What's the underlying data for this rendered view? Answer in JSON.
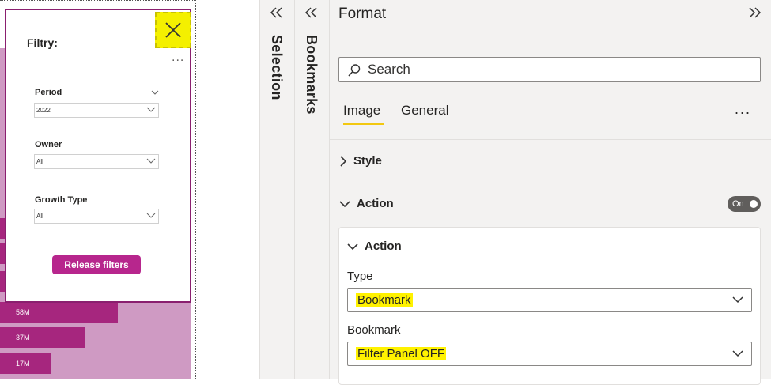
{
  "canvas": {
    "bars": [
      {
        "label": "58M"
      },
      {
        "label": "37M"
      },
      {
        "label": "17M"
      }
    ],
    "filter_panel": {
      "title": "Filtry:",
      "more": "...",
      "slicers": [
        {
          "label": "Period",
          "value": "2022"
        },
        {
          "label": "Owner",
          "value": "All"
        },
        {
          "label": "Growth Type",
          "value": "All"
        }
      ],
      "release_button": "Release filters"
    }
  },
  "panes": {
    "selection": {
      "label": "Selection"
    },
    "bookmarks": {
      "label": "Bookmarks"
    },
    "format": {
      "title": "Format",
      "search": {
        "placeholder": "Search"
      },
      "tabs": [
        {
          "label": "Image",
          "active": true
        },
        {
          "label": "General",
          "active": false
        }
      ],
      "more": "...",
      "sections": {
        "style": {
          "label": "Style"
        },
        "action": {
          "label": "Action",
          "toggle": "On"
        }
      },
      "action_card": {
        "header": "Action",
        "type_label": "Type",
        "type_value": "Bookmark",
        "bookmark_label": "Bookmark",
        "bookmark_value": "Filter Panel OFF"
      }
    }
  },
  "colors": {
    "accent_yellow": "#f2c811",
    "highlight": "#fff200",
    "report_magenta": "#a6267e"
  }
}
